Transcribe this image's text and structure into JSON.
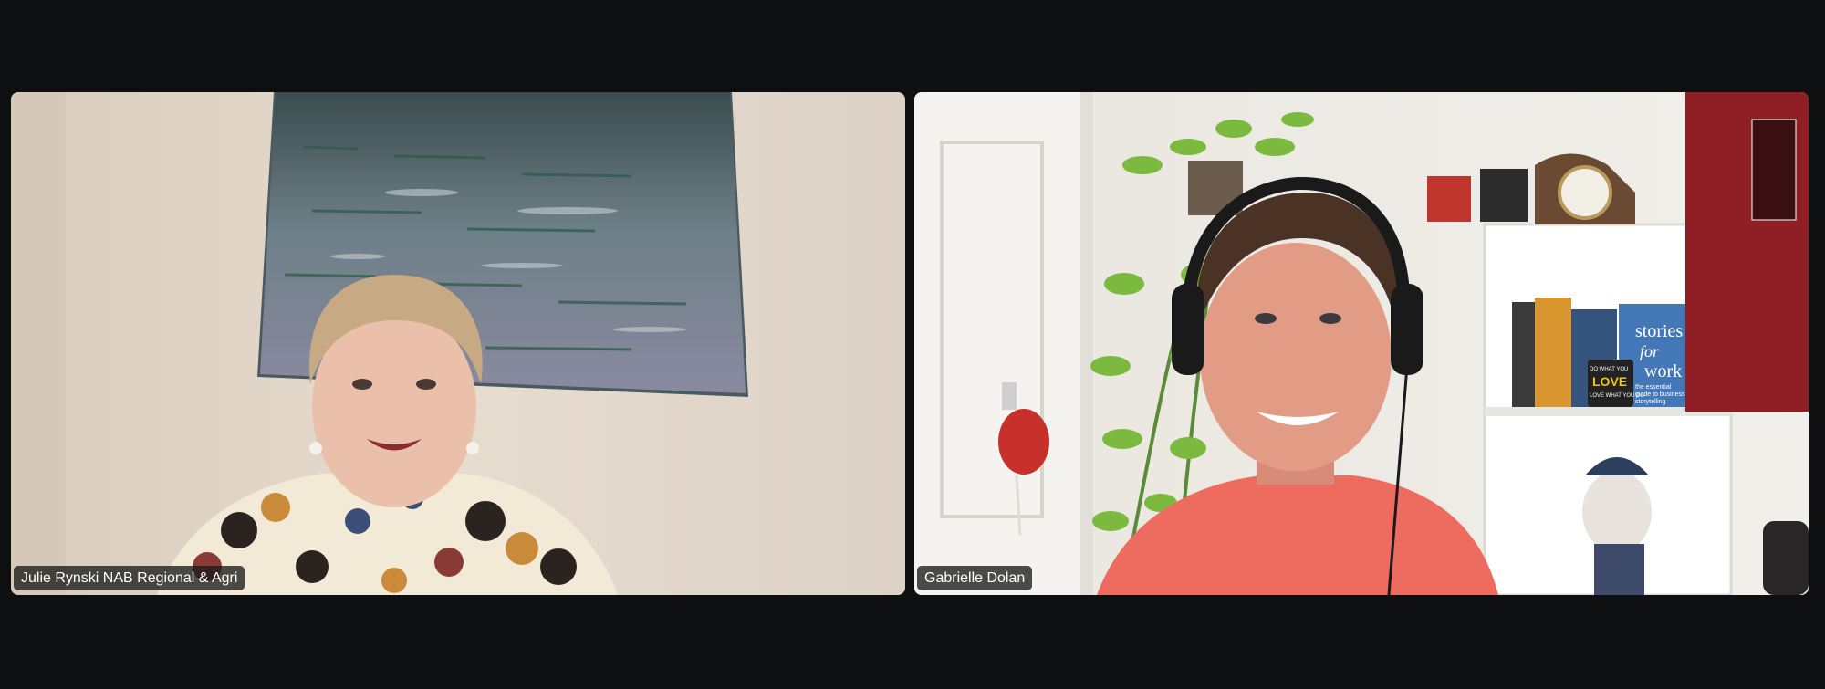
{
  "meeting": {
    "participants": [
      {
        "name": "Julie Rynski NAB Regional & Agri"
      },
      {
        "name": "Gabrielle Dolan"
      }
    ]
  },
  "background": {
    "book_title_line1": "stories",
    "book_title_line2": "for",
    "book_title_line3": "work",
    "book_subtitle_line1": "the essential",
    "book_subtitle_line2": "guide to business",
    "book_subtitle_line3": "storytelling",
    "mug_text_line1": "DO WHAT YOU",
    "mug_text_line2": "LOVE",
    "mug_text_line3": "LOVE WHAT YOU DO"
  },
  "colors": {
    "app_background": "#0e0f10",
    "name_tag_background": "#191919",
    "name_tag_text": "#ffffff"
  },
  "icons": [
    "painting",
    "plant",
    "headphones",
    "clock",
    "bookshelf",
    "figurine"
  ]
}
